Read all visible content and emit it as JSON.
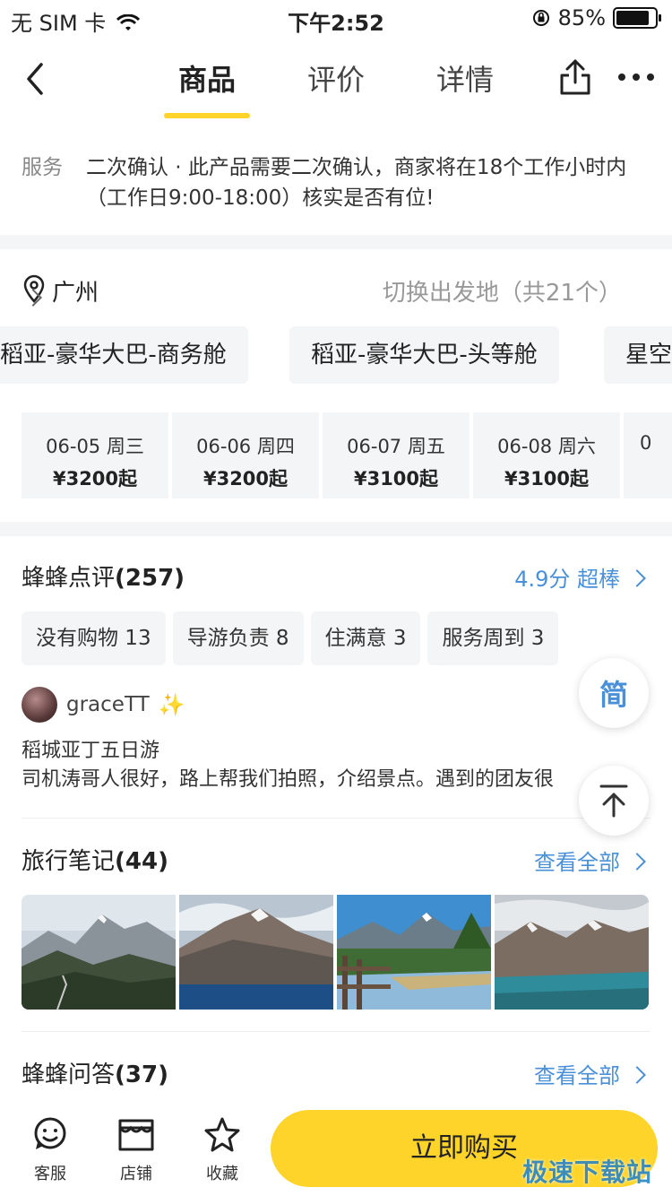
{
  "status": {
    "carrier": "无 SIM 卡",
    "time": "下午2:52",
    "battery": "85%"
  },
  "nav": {
    "tabs": [
      "商品",
      "评价",
      "详情"
    ]
  },
  "service": {
    "label": "服务",
    "line1": "二次确认 · 此产品需要二次确认，商家将在18个工作小时内",
    "line2": "（工作日9:00-18:00）核实是否有位!"
  },
  "location": {
    "city": "广州",
    "switch": "切换出发地（共21个）"
  },
  "routes": [
    "稻亚-豪华大巴-商务舱",
    "稻亚-豪华大巴-头等舱",
    "星空"
  ],
  "dates": [
    {
      "date": "06-05 周三",
      "price": "¥3200起"
    },
    {
      "date": "06-06 周四",
      "price": "¥3200起"
    },
    {
      "date": "06-07 周五",
      "price": "¥3100起"
    },
    {
      "date": "06-08 周六",
      "price": "¥3100起"
    },
    {
      "date": "0",
      "price": ""
    }
  ],
  "reviews": {
    "title": "蜂蜂点评",
    "count": "(257)",
    "score": "4.9分 超棒",
    "tags": [
      "没有购物 13",
      "导游负责 8",
      "住满意 3",
      "服务周到 3"
    ],
    "user": "graceTT",
    "user_badge": "✨",
    "product": "稻城亚丁五日游",
    "text": "司机涛哥人很好，路上帮我们拍照，介绍景点。遇到的团友很"
  },
  "notes": {
    "title": "旅行笔记",
    "count": "(44)",
    "link": "查看全部"
  },
  "qa": {
    "title": "蜂蜂问答",
    "count": "(37)",
    "link": "查看全部"
  },
  "floating": {
    "simplified": "简"
  },
  "bottom": {
    "service": "客服",
    "shop": "店铺",
    "favorite": "收藏",
    "buy": "立即购买"
  },
  "watermark": "极速下载站",
  "colors": {
    "accent": "#FFD42A",
    "link": "#4A90D9"
  }
}
